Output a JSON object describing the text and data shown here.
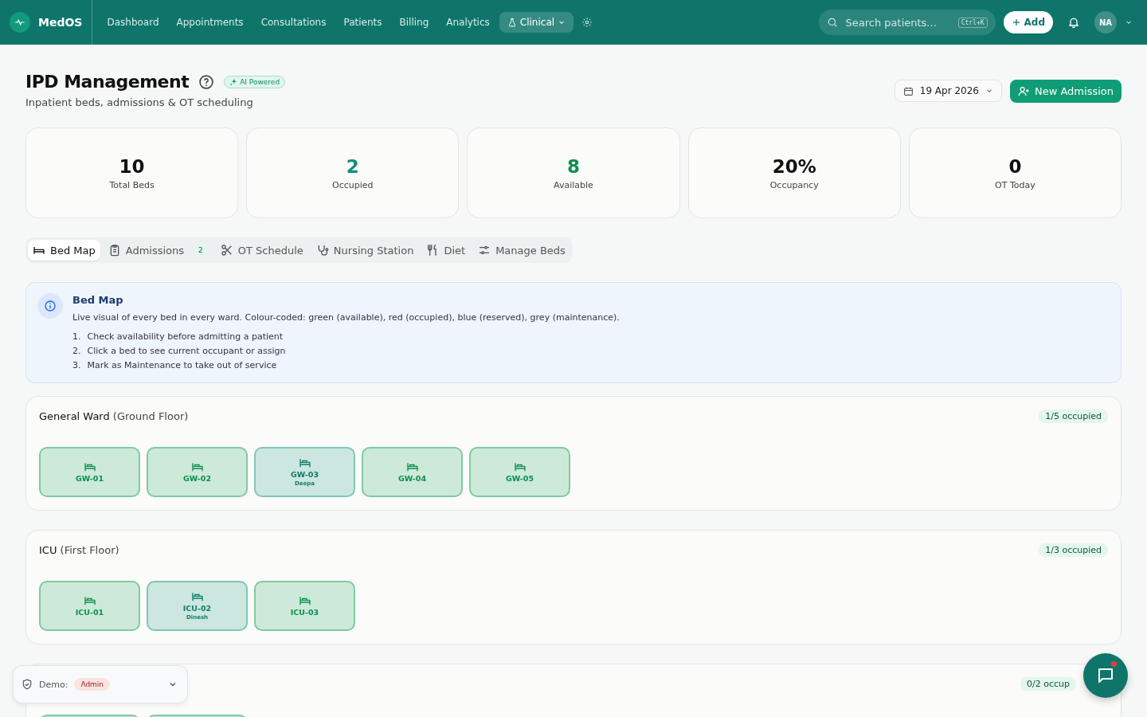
{
  "app": {
    "name": "MedOS"
  },
  "nav": [
    {
      "label": "Dashboard",
      "selected": false,
      "kind": "link"
    },
    {
      "label": "Appointments",
      "selected": false,
      "kind": "link"
    },
    {
      "label": "Consultations",
      "selected": false,
      "kind": "link"
    },
    {
      "label": "Patients",
      "selected": false,
      "kind": "link"
    },
    {
      "label": "Billing",
      "selected": false,
      "kind": "link"
    },
    {
      "label": "Analytics",
      "selected": false,
      "kind": "link"
    },
    {
      "label": "Clinical",
      "selected": true,
      "kind": "menu"
    }
  ],
  "search": {
    "placeholder": "Search patients...",
    "shortcut": "Ctrl+K"
  },
  "add_button": "Add",
  "user": {
    "initials": "NA"
  },
  "page": {
    "title": "IPD Management",
    "badge": "AI Powered",
    "subtitle": "Inpatient beds, admissions & OT scheduling",
    "date": "19 Apr 2026",
    "primary_button": "New Admission"
  },
  "stats": [
    {
      "value": "10",
      "label": "Total Beds",
      "color": "#111111"
    },
    {
      "value": "2",
      "label": "Occupied",
      "color": "#0f8f7c"
    },
    {
      "value": "8",
      "label": "Available",
      "color": "#0a8f4e"
    },
    {
      "value": "20%",
      "label": "Occupancy",
      "color": "#111111"
    },
    {
      "value": "0",
      "label": "OT Today",
      "color": "#111111"
    }
  ],
  "tabs": [
    {
      "label": "Bed Map",
      "kind": "bed",
      "selected": true
    },
    {
      "label": "Admissions",
      "kind": "clipboard",
      "selected": false,
      "count": "2"
    },
    {
      "label": "OT Schedule",
      "kind": "scissors",
      "selected": false
    },
    {
      "label": "Nursing Station",
      "kind": "stethoscope",
      "selected": false
    },
    {
      "label": "Diet",
      "kind": "utensils",
      "selected": false
    },
    {
      "label": "Manage Beds",
      "kind": "sliders",
      "selected": false
    }
  ],
  "info": {
    "title": "Bed Map",
    "text": "Live visual of every bed in every ward. Colour-coded: green (available), red (occupied), blue (reserved), grey (maintenance).",
    "steps": [
      {
        "num": "1.",
        "text": "Check availability before admitting a patient"
      },
      {
        "num": "2.",
        "text": "Click a bed to see current occupant or assign"
      },
      {
        "num": "3.",
        "text": "Mark as Maintenance to take out of service"
      }
    ]
  },
  "wards": [
    {
      "name": "General Ward",
      "floor": "(Ground Floor)",
      "occupancy": "1/5 occupied",
      "beds": [
        {
          "label": "GW-01",
          "occupied": false
        },
        {
          "label": "GW-02",
          "occupied": false
        },
        {
          "label": "GW-03",
          "occupied": true,
          "patient": "Deepa"
        },
        {
          "label": "GW-04",
          "occupied": false
        },
        {
          "label": "GW-05",
          "occupied": false
        }
      ]
    },
    {
      "name": "ICU",
      "floor": "(First Floor)",
      "occupancy": "1/3 occupied",
      "beds": [
        {
          "label": "ICU-01",
          "occupied": false
        },
        {
          "label": "ICU-02",
          "occupied": true,
          "patient": "Dinesh"
        },
        {
          "label": "ICU-03",
          "occupied": false
        }
      ]
    },
    {
      "occupancy": "0/2 occup",
      "beds": [
        {
          "occupied": false
        },
        {
          "occupied": false
        }
      ]
    }
  ],
  "demo": {
    "label": "Demo:",
    "role": "Admin"
  },
  "chat": {
    "unread": true
  }
}
